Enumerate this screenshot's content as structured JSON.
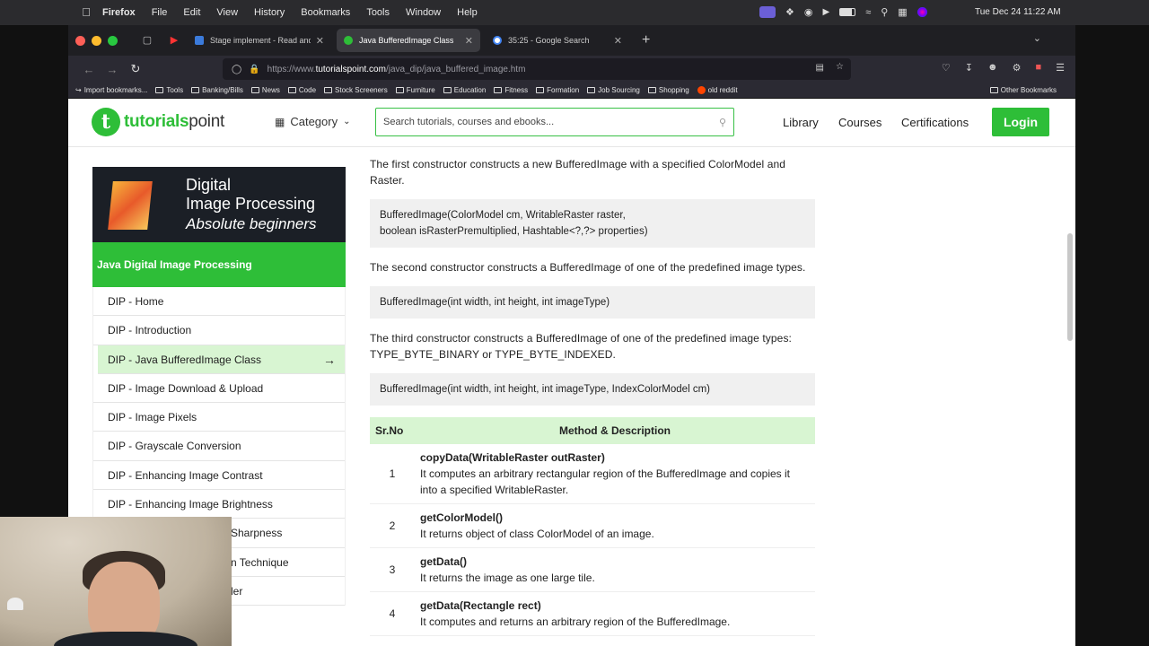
{
  "menubar": {
    "app": "Firefox",
    "items": [
      "File",
      "Edit",
      "View",
      "History",
      "Bookmarks",
      "Tools",
      "Window",
      "Help"
    ],
    "clock": "Tue Dec 24  11:22 AM"
  },
  "browser": {
    "tabs": [
      {
        "title": "Stage implement - Read and Wr",
        "active": false
      },
      {
        "title": "Java BufferedImage Class",
        "active": true
      },
      {
        "title": "35:25 - Google Search",
        "active": false
      }
    ],
    "url_prefix": "https://www.",
    "url_host": "tutorialspoint.com",
    "url_path": "/java_dip/java_buffered_image.htm",
    "bookmarks": [
      "Import bookmarks...",
      "Tools",
      "Banking/Bills",
      "News",
      "Code",
      "Stock Screeners",
      "Furniture",
      "Education",
      "Fitness",
      "Formation",
      "Job Sourcing",
      "Shopping",
      "old reddit"
    ],
    "other_bookmarks": "Other Bookmarks"
  },
  "site": {
    "logo_main": "tutorials",
    "logo_sub": "point",
    "category": "Category",
    "search_placeholder": "Search tutorials, courses and ebooks...",
    "nav": [
      "Library",
      "Courses",
      "Certifications"
    ],
    "login": "Login"
  },
  "sidebar": {
    "banner_line1": "Digital",
    "banner_line2": "Image Processing",
    "banner_line3": "Absolute beginners",
    "heading": "Java Digital Image Processing",
    "items": [
      {
        "label": "DIP - Home"
      },
      {
        "label": "DIP - Introduction"
      },
      {
        "label": "DIP - Java BufferedImage Class"
      },
      {
        "label": "DIP - Image Download & Upload"
      },
      {
        "label": "DIP - Image Pixels"
      },
      {
        "label": "DIP - Grayscale Conversion"
      },
      {
        "label": "DIP - Enhancing Image Contrast"
      },
      {
        "label": "DIP - Enhancing Image Brightness"
      },
      {
        "label": "Sharpness"
      },
      {
        "label": "n Technique"
      },
      {
        "label": "ler"
      }
    ]
  },
  "content": {
    "p1": "The first constructor constructs a new BufferedImage with a specified ColorModel and Raster.",
    "code1_l1": "BufferedImage(ColorModel cm, WritableRaster raster,",
    "code1_l2": "boolean isRasterPremultiplied, Hashtable<?,?> properties)",
    "p2": "The second constructor constructs a BufferedImage of one of the predefined image types.",
    "code2": "BufferedImage(int width, int height, int imageType)",
    "p3": "The third constructor constructs a BufferedImage of one of the predefined image types: TYPE_BYTE_BINARY or TYPE_BYTE_INDEXED.",
    "code3": "BufferedImage(int width, int height, int imageType, IndexColorModel cm)",
    "table_header_no": "Sr.No",
    "table_header_desc": "Method & Description",
    "rows": [
      {
        "no": "1",
        "method": "copyData(WritableRaster outRaster)",
        "desc": "It computes an arbitrary rectangular region of the BufferedImage and copies it into a specified WritableRaster."
      },
      {
        "no": "2",
        "method": "getColorModel()",
        "desc": "It returns object of class ColorModel of an image."
      },
      {
        "no": "3",
        "method": "getData()",
        "desc": "It returns the image as one large tile."
      },
      {
        "no": "4",
        "method": "getData(Rectangle rect)",
        "desc": "It computes and returns an arbitrary region of the BufferedImage."
      }
    ]
  }
}
